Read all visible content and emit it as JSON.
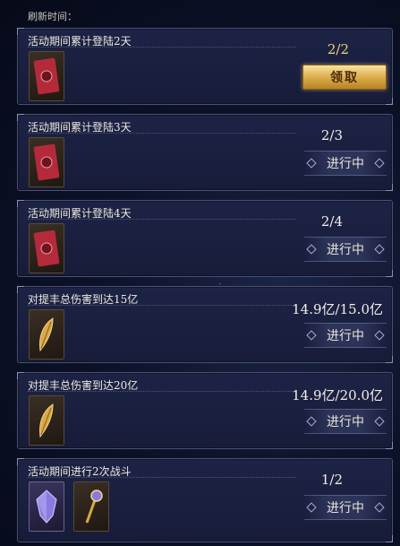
{
  "header": {
    "refresh_label": "刷新时间："
  },
  "tasks": [
    {
      "title": "活动期间累计登陆2天",
      "progress": "2/2",
      "button": "领取",
      "state": "claim"
    },
    {
      "title": "活动期间累计登陆3天",
      "progress": "2/3",
      "button": "进行中",
      "state": "ongoing"
    },
    {
      "title": "活动期间累计登陆4天",
      "progress": "2/4",
      "button": "进行中",
      "state": "ongoing"
    },
    {
      "title": "对提丰总伤害到达15亿",
      "progress": "14.9亿/15.0亿",
      "button": "进行中",
      "state": "ongoing"
    },
    {
      "title": "对提丰总伤害到达20亿",
      "progress": "14.9亿/20.0亿",
      "button": "进行中",
      "state": "ongoing"
    },
    {
      "title": "活动期间进行2次战斗",
      "progress": "1/2",
      "button": "进行中",
      "state": "ongoing"
    }
  ],
  "icons": {
    "red_card": "red-card-icon",
    "gold_feather": "gold-feather-icon",
    "purple_crystal": "purple-crystal-icon",
    "gold_staff": "gold-staff-icon"
  },
  "colors": {
    "claim_gold": "#d9a947",
    "progress_gold": "#f1d27a",
    "card_border": "#4a5175"
  }
}
